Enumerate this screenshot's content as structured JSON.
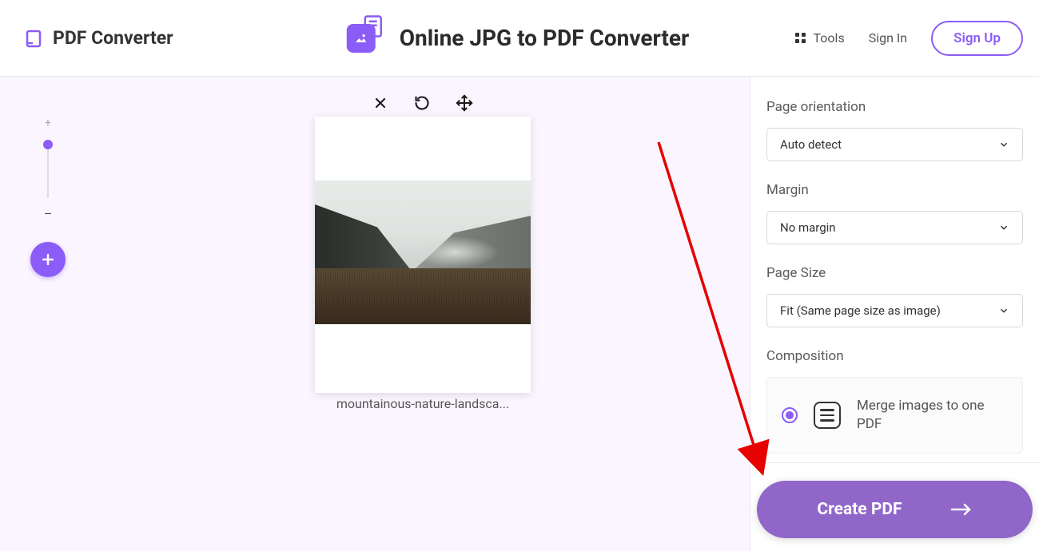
{
  "header": {
    "brand": "PDF Converter",
    "page_title": "Online JPG to PDF Converter",
    "tools_label": "Tools",
    "signin_label": "Sign In",
    "signup_label": "Sign Up"
  },
  "canvas": {
    "filename": "mountainous-nature-landsca..."
  },
  "options": {
    "orientation_label": "Page orientation",
    "orientation_value": "Auto detect",
    "margin_label": "Margin",
    "margin_value": "No margin",
    "pagesize_label": "Page Size",
    "pagesize_value": "Fit (Same page size as image)",
    "composition_label": "Composition",
    "composition_value": "Merge images to one PDF"
  },
  "action": {
    "create_label": "Create PDF"
  },
  "colors": {
    "accent": "#8b5cf6"
  }
}
